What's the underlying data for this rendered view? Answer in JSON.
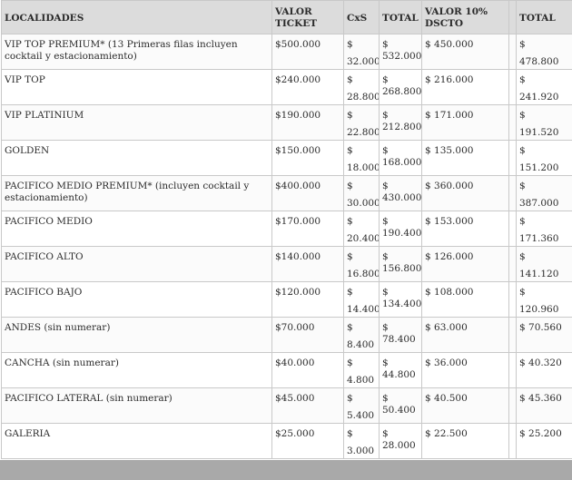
{
  "table": {
    "headers": [
      "LOCALIDADES",
      "VALOR TICKET",
      "CxS",
      "TOTAL",
      "VALOR 10% DSCTO",
      "",
      "TOTAL"
    ],
    "rows": [
      {
        "localidad": "VIP TOP PREMIUM* (13 Primeras filas incluyen cocktail y estacionamiento)",
        "ticket": "$500.000",
        "cxs_cur": "$",
        "cxs_amt": "32.000",
        "total_cur": "$",
        "total_amt": "532.000",
        "dscto": "$ 450.000",
        "total2_cur": "$",
        "total2_amt": "478.800"
      },
      {
        "localidad": "VIP TOP",
        "ticket": "$240.000",
        "cxs_cur": "$",
        "cxs_amt": "28.800",
        "total_cur": "$",
        "total_amt": "268.800",
        "dscto": "$ 216.000",
        "total2_cur": "$",
        "total2_amt": "241.920"
      },
      {
        "localidad": "VIP PLATINIUM",
        "ticket": "$190.000",
        "cxs_cur": "$",
        "cxs_amt": "22.800",
        "total_cur": "$",
        "total_amt": "212.800",
        "dscto": "$ 171.000",
        "total2_cur": "$",
        "total2_amt": "191.520"
      },
      {
        "localidad": "GOLDEN",
        "ticket": "$150.000",
        "cxs_cur": "$",
        "cxs_amt": "18.000",
        "total_cur": "$",
        "total_amt": "168.000",
        "dscto": "$ 135.000",
        "total2_cur": "$",
        "total2_amt": "151.200"
      },
      {
        "localidad": "PACIFICO MEDIO PREMIUM* (incluyen cocktail y estacionamiento)",
        "ticket": "$400.000",
        "cxs_cur": "$",
        "cxs_amt": "30.000",
        "total_cur": "$",
        "total_amt": "430.000",
        "dscto": "$ 360.000",
        "total2_cur": "$",
        "total2_amt": "387.000"
      },
      {
        "localidad": "PACIFICO MEDIO",
        "ticket": "$170.000",
        "cxs_cur": "$",
        "cxs_amt": "20.400",
        "total_cur": "$",
        "total_amt": "190.400",
        "dscto": "$ 153.000",
        "total2_cur": "$",
        "total2_amt": "171.360"
      },
      {
        "localidad": "PACIFICO ALTO",
        "ticket": "$140.000",
        "cxs_cur": "$",
        "cxs_amt": "16.800",
        "total_cur": "$",
        "total_amt": "156.800",
        "dscto": "$ 126.000",
        "total2_cur": "$",
        "total2_amt": "141.120"
      },
      {
        "localidad": "PACIFICO BAJO",
        "ticket": "$120.000",
        "cxs_cur": "$",
        "cxs_amt": "14.400",
        "total_cur": "$",
        "total_amt": "134.400",
        "dscto": "$ 108.000",
        "total2_cur": "$",
        "total2_amt": "120.960"
      },
      {
        "localidad": "ANDES (sin numerar)",
        "ticket": "$70.000",
        "cxs_cur": "$",
        "cxs_amt": "8.400",
        "total_cur": "$ 78.400",
        "total_amt": "",
        "dscto": "$ 63.000",
        "total2_cur": "$ 70.560",
        "total2_amt": ""
      },
      {
        "localidad": "CANCHA (sin numerar)",
        "ticket": "$40.000",
        "cxs_cur": "$",
        "cxs_amt": "4.800",
        "total_cur": "$ 44.800",
        "total_amt": "",
        "dscto": "$ 36.000",
        "total2_cur": "$ 40.320",
        "total2_amt": ""
      },
      {
        "localidad": "PACIFICO LATERAL (sin numerar)",
        "ticket": "$45.000",
        "cxs_cur": "$",
        "cxs_amt": "5.400",
        "total_cur": "$ 50.400",
        "total_amt": "",
        "dscto": "$ 40.500",
        "total2_cur": "$ 45.360",
        "total2_amt": ""
      },
      {
        "localidad": "GALERIA",
        "ticket": "$25.000",
        "cxs_cur": "$",
        "cxs_amt": "3.000",
        "total_cur": "$ 28.000",
        "total_amt": "",
        "dscto": "$ 22.500",
        "total2_cur": "$ 25.200",
        "total2_amt": ""
      }
    ]
  },
  "colors": {
    "header_bg": "#dcdcdc",
    "border": "#c9c9c9",
    "footer_bar": "#a9a9a9"
  }
}
